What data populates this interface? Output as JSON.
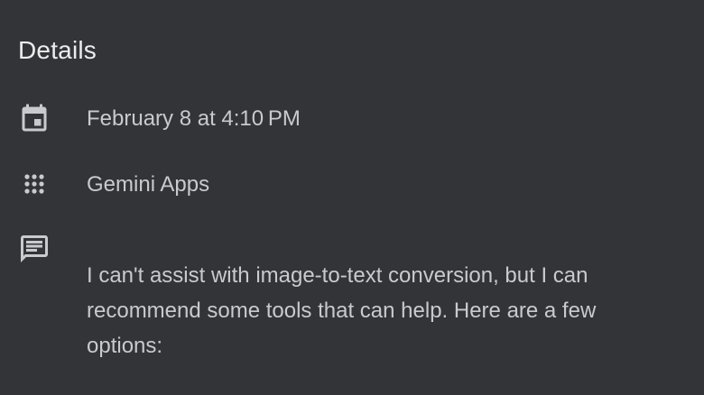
{
  "header": {
    "title": "Details"
  },
  "details": {
    "date": {
      "icon": "calendar-icon",
      "text": "February 8 at 4:10 PM"
    },
    "app": {
      "icon": "apps-grid-icon",
      "text": "Gemini Apps"
    },
    "message": {
      "icon": "comment-icon",
      "text": "I can't assist with image-to-text conversion, but I can recommend some tools that can help. Here are a few options:"
    }
  },
  "colors": {
    "background": "#333438",
    "title": "#ececee",
    "text": "#c8cacd",
    "icon": "#c8cacd"
  }
}
